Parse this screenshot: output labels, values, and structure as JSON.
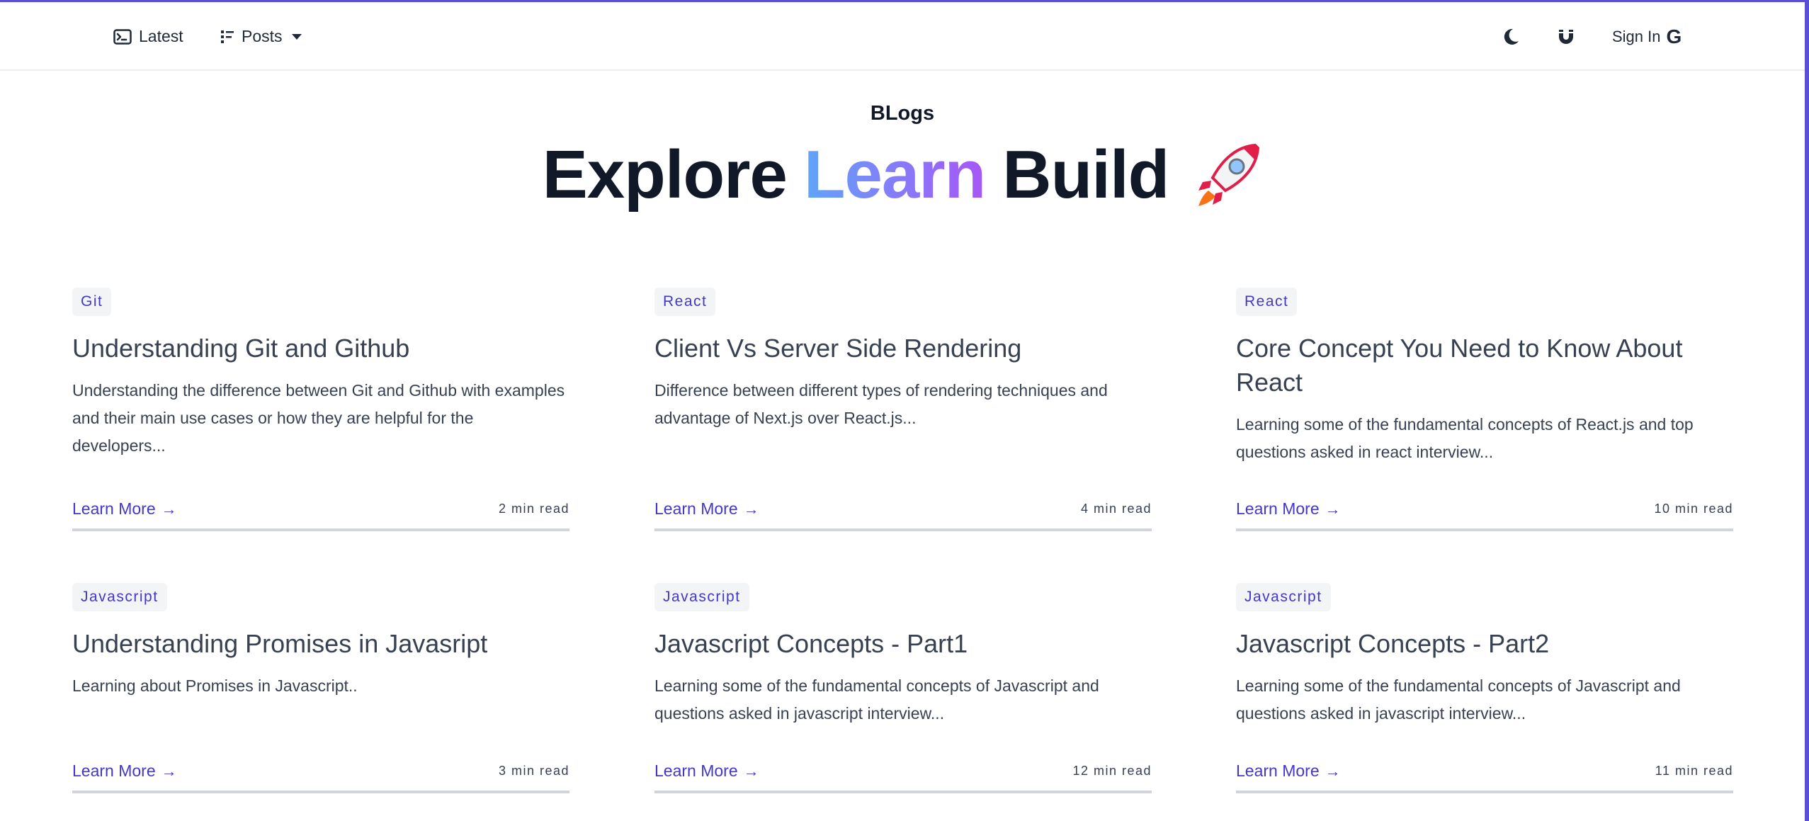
{
  "nav": {
    "latest_label": "Latest",
    "posts_label": "Posts",
    "signin_label": "Sign In",
    "signin_glyph": "G"
  },
  "hero": {
    "small_title": "BLogs",
    "word1": "Explore",
    "word2": "Learn",
    "word3": "Build"
  },
  "posts": [
    {
      "tag": "Git",
      "title": "Understanding Git and Github",
      "description": "Understanding the difference between Git and Github with examples and their main use cases or how they are helpful for the developers...",
      "cta": "Learn More",
      "read_time": "2 min read"
    },
    {
      "tag": "React",
      "title": "Client Vs Server Side Rendering",
      "description": "Difference between different types of rendering techniques and advantage of Next.js over React.js...",
      "cta": "Learn More",
      "read_time": "4 min read"
    },
    {
      "tag": "React",
      "title": "Core Concept You Need to Know About React",
      "description": "Learning some of the fundamental concepts of React.js and top questions asked in react interview...",
      "cta": "Learn More",
      "read_time": "10 min read"
    },
    {
      "tag": "Javascript",
      "title": "Understanding Promises in Javasript",
      "description": "Learning about Promises in Javascript..",
      "cta": "Learn More",
      "read_time": "3 min read"
    },
    {
      "tag": "Javascript",
      "title": "Javascript Concepts - Part1",
      "description": "Learning some of the fundamental concepts of Javascript and questions asked in javascript interview...",
      "cta": "Learn More",
      "read_time": "12 min read"
    },
    {
      "tag": "Javascript",
      "title": "Javascript Concepts - Part2",
      "description": "Learning some of the fundamental concepts of Javascript and questions asked in javascript interview...",
      "cta": "Learn More",
      "read_time": "11 min read"
    }
  ],
  "colors": {
    "accent": "#4338ca",
    "brand_bar": "#5b4fd6",
    "gradient_start": "#60a5fa",
    "gradient_end": "#a855f7"
  },
  "icons": {
    "latest": "terminal-icon",
    "posts": "list-icon",
    "theme": "moon-icon",
    "extra": "magnet-icon",
    "hero": "rocket-icon"
  }
}
